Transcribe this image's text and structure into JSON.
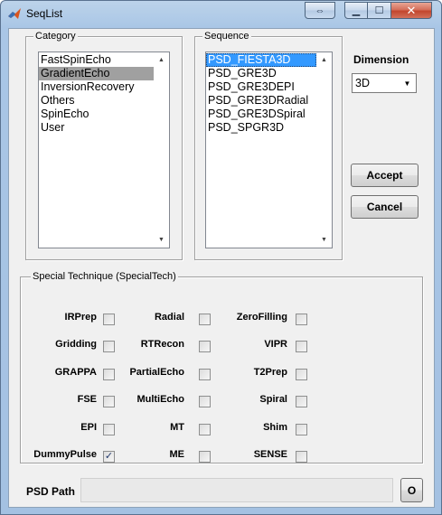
{
  "window": {
    "title": "SeqList",
    "dock_symbol": "⇔",
    "min_symbol": "▁",
    "max_symbol": "☐",
    "close_symbol": "✕",
    "app_icon": "matlab-icon"
  },
  "category": {
    "title": "Category",
    "items": [
      "FastSpinEcho",
      "GradientEcho",
      "InversionRecovery",
      "Others",
      "SpinEcho",
      "User"
    ],
    "selected": "GradientEcho"
  },
  "sequence": {
    "title": "Sequence",
    "items": [
      "PSD_FIESTA3D",
      "PSD_GRE3D",
      "PSD_GRE3DEPI",
      "PSD_GRE3DRadial",
      "PSD_GRE3DSpiral",
      "PSD_SPGR3D"
    ],
    "selected": "PSD_FIESTA3D"
  },
  "scroll": {
    "up": "▲",
    "down": "▼"
  },
  "dimension": {
    "label": "Dimension",
    "value": "3D",
    "arrow": "▼"
  },
  "buttons": {
    "accept": "Accept",
    "cancel": "Cancel",
    "open": "O"
  },
  "special": {
    "title": "Special Technique (SpecialTech)",
    "check_mark": "✓",
    "rows": [
      [
        {
          "label": "IRPrep",
          "checked": false
        },
        {
          "label": "Radial",
          "checked": false
        },
        {
          "label": "ZeroFilling",
          "checked": false
        }
      ],
      [
        {
          "label": "Gridding",
          "checked": false
        },
        {
          "label": "RTRecon",
          "checked": false
        },
        {
          "label": "VIPR",
          "checked": false
        }
      ],
      [
        {
          "label": "GRAPPA",
          "checked": false
        },
        {
          "label": "PartialEcho",
          "checked": false
        },
        {
          "label": "T2Prep",
          "checked": false
        }
      ],
      [
        {
          "label": "FSE",
          "checked": false
        },
        {
          "label": "MultiEcho",
          "checked": false
        },
        {
          "label": "Spiral",
          "checked": false
        }
      ],
      [
        {
          "label": "EPI",
          "checked": false
        },
        {
          "label": "MT",
          "checked": false
        },
        {
          "label": "Shim",
          "checked": false
        }
      ],
      [
        {
          "label": "DummyPulse",
          "checked": true
        },
        {
          "label": "ME",
          "checked": false
        },
        {
          "label": "SENSE",
          "checked": false
        }
      ]
    ]
  },
  "psd_path": {
    "label": "PSD Path",
    "value": ""
  }
}
